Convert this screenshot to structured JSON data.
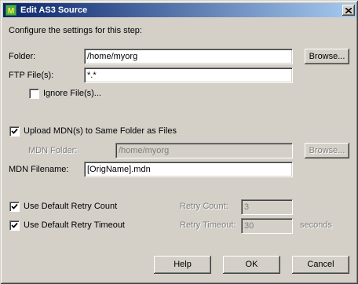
{
  "window": {
    "title": "Edit AS3 Source"
  },
  "intro": "Configure the settings for this step:",
  "folder": {
    "label": "Folder:",
    "value": "/home/myorg",
    "browse_label": "Browse..."
  },
  "ftp_files": {
    "label": "FTP File(s):",
    "value": "*.*"
  },
  "ignore_files": {
    "label": "Ignore File(s)...",
    "checked": false
  },
  "upload_mdn": {
    "label": "Upload MDN(s) to Same Folder as Files",
    "checked": true
  },
  "mdn_folder": {
    "label": "MDN Folder:",
    "value": "/home/myorg",
    "browse_label": "Browse..."
  },
  "mdn_filename": {
    "label": "MDN Filename:",
    "value": "[OrigName].mdn"
  },
  "retry_count": {
    "checkbox_label": "Use Default Retry Count",
    "checked": true,
    "label": "Retry Count:",
    "value": "3"
  },
  "retry_timeout": {
    "checkbox_label": "Use Default Retry Timeout",
    "checked": true,
    "label": "Retry Timeout:",
    "value": "30",
    "unit": "seconds"
  },
  "buttons": {
    "help": "Help",
    "ok": "OK",
    "cancel": "Cancel"
  }
}
